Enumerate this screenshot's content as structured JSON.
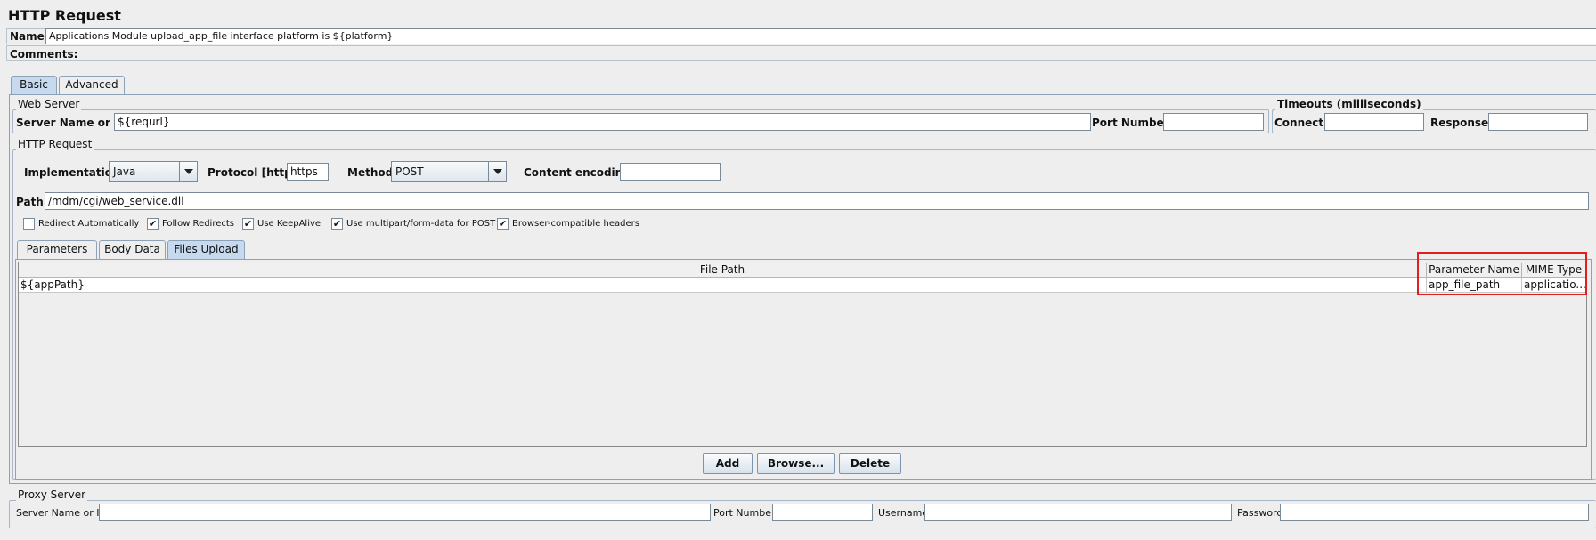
{
  "header": {
    "title": "HTTP Request"
  },
  "name_row": {
    "label": "Name:",
    "value": "Applications Module upload_app_file interface platform is ${platform}"
  },
  "comments_row": {
    "label": "Comments:",
    "value": ""
  },
  "main_tabs": [
    {
      "label": "Basic",
      "active": true
    },
    {
      "label": "Advanced",
      "active": false
    }
  ],
  "web_server": {
    "legend": "Web Server",
    "server_label": "Server Name or IP:",
    "server_value": "${requrl}",
    "port_label": "Port Number:",
    "port_value": ""
  },
  "timeouts": {
    "legend": "Timeouts (milliseconds)",
    "connect_label": "Connect:",
    "connect_value": "",
    "response_label": "Response:",
    "response_value": ""
  },
  "http_request": {
    "legend": "HTTP Request",
    "implementation_label": "Implementation:",
    "implementation_value": "Java",
    "protocol_label": "Protocol [http]:",
    "protocol_value": "https",
    "method_label": "Method:",
    "method_value": "POST",
    "encoding_label": "Content encoding:",
    "encoding_value": "",
    "path_label": "Path:",
    "path_value": "/mdm/cgi/web_service.dll"
  },
  "checkboxes": [
    {
      "label": "Redirect Automatically",
      "checked": false
    },
    {
      "label": "Follow Redirects",
      "checked": true
    },
    {
      "label": "Use KeepAlive",
      "checked": true
    },
    {
      "label": "Use multipart/form-data for POST",
      "checked": true
    },
    {
      "label": "Browser-compatible headers",
      "checked": true
    }
  ],
  "sub_tabs": [
    {
      "label": "Parameters",
      "active": false
    },
    {
      "label": "Body Data",
      "active": false
    },
    {
      "label": "Files Upload",
      "active": true
    }
  ],
  "files_table": {
    "headers": [
      "File Path",
      "Parameter Name",
      "MIME Type"
    ],
    "rows": [
      [
        "${appPath}",
        "app_file_path",
        "applicatio..."
      ]
    ]
  },
  "buttons": {
    "add": "Add",
    "browse": "Browse...",
    "delete": "Delete"
  },
  "proxy": {
    "legend": "Proxy Server",
    "server_label": "Server Name or IP:",
    "port_label": "Port Number:",
    "username_label": "Username",
    "password_label": "Password"
  },
  "colors": {
    "highlight_box": "#e02020",
    "active_tab": "#c6d9ef",
    "panel_bg": "#eeeeee"
  }
}
